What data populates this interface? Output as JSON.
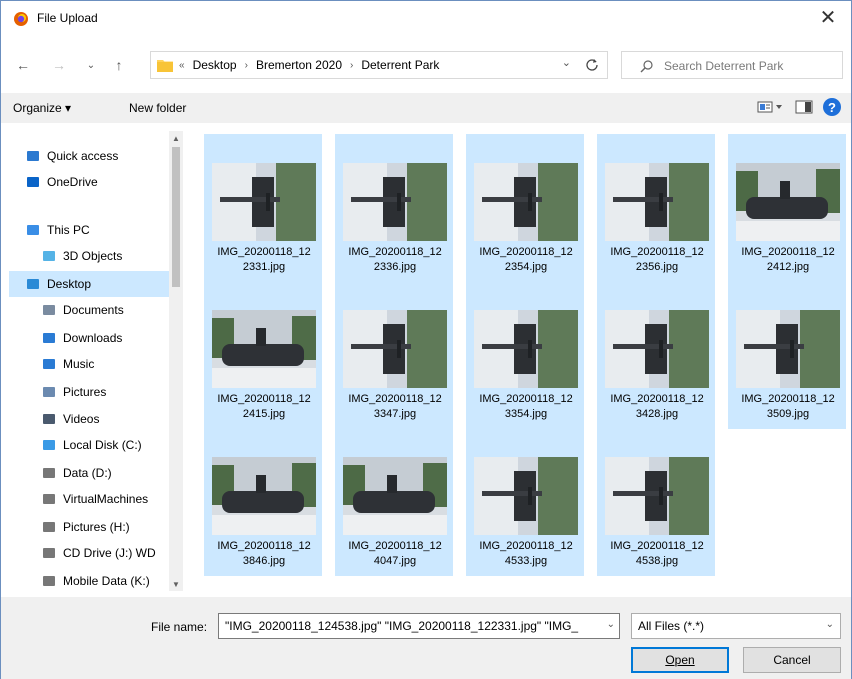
{
  "window": {
    "title": "File Upload",
    "close_glyph": "✕"
  },
  "nav": {
    "back_glyph": "←",
    "forward_glyph": "→",
    "recent_glyph": "⌄",
    "up_glyph": "↑",
    "prefix_glyph": "«",
    "breadcrumbs": [
      "Desktop",
      "Bremerton 2020",
      "Deterrent Park"
    ],
    "separator": "›",
    "search_placeholder": "Search Deterrent Park"
  },
  "commands": {
    "organize": "Organize ▾",
    "new_folder": "New folder",
    "help": "?"
  },
  "sidebar": {
    "items": [
      {
        "label": "Quick access",
        "icon": "star-icon",
        "color": "#2b79d0"
      },
      {
        "label": "OneDrive",
        "icon": "cloud-icon",
        "color": "#0a64c8"
      },
      {
        "label": "This PC",
        "icon": "computer-icon",
        "color": "#3a8ee6"
      },
      {
        "label": "3D Objects",
        "icon": "cube-icon",
        "color": "#55b3e6"
      },
      {
        "label": "Desktop",
        "icon": "desktop-icon",
        "color": "#2a8ad6",
        "selected": true
      },
      {
        "label": "Documents",
        "icon": "document-icon",
        "color": "#7a8ba0"
      },
      {
        "label": "Downloads",
        "icon": "download-icon",
        "color": "#2a7bd4"
      },
      {
        "label": "Music",
        "icon": "music-icon",
        "color": "#2a7bd4"
      },
      {
        "label": "Pictures",
        "icon": "pictures-icon",
        "color": "#6b8ab0"
      },
      {
        "label": "Videos",
        "icon": "videos-icon",
        "color": "#4a5a6e"
      },
      {
        "label": "Local Disk (C:)",
        "icon": "disk-icon",
        "color": "#3a9ae6"
      },
      {
        "label": "Data (D:)",
        "icon": "drive-icon",
        "color": "#777777"
      },
      {
        "label": "VirtualMachines",
        "icon": "drive-icon",
        "color": "#777777"
      },
      {
        "label": "Pictures (H:)",
        "icon": "drive-icon",
        "color": "#777777"
      },
      {
        "label": "CD Drive (J:) WD",
        "icon": "cd-icon",
        "color": "#777777"
      },
      {
        "label": "Mobile Data (K:)",
        "icon": "drive-icon",
        "color": "#777777"
      }
    ]
  },
  "files": [
    {
      "name": "IMG_20200118_122331.jpg",
      "line1": "IMG_20200118_12",
      "line2": "2331.jpg",
      "rotated": true
    },
    {
      "name": "IMG_20200118_122336.jpg",
      "line1": "IMG_20200118_12",
      "line2": "2336.jpg",
      "rotated": true
    },
    {
      "name": "IMG_20200118_122354.jpg",
      "line1": "IMG_20200118_12",
      "line2": "2354.jpg",
      "rotated": true
    },
    {
      "name": "IMG_20200118_122356.jpg",
      "line1": "IMG_20200118_12",
      "line2": "2356.jpg",
      "rotated": true
    },
    {
      "name": "IMG_20200118_122412.jpg",
      "line1": "IMG_20200118_12",
      "line2": "2412.jpg",
      "rotated": false
    },
    {
      "name": "IMG_20200118_122415.jpg",
      "line1": "IMG_20200118_12",
      "line2": "2415.jpg",
      "rotated": false
    },
    {
      "name": "IMG_20200118_123347.jpg",
      "line1": "IMG_20200118_12",
      "line2": "3347.jpg",
      "rotated": true
    },
    {
      "name": "IMG_20200118_123354.jpg",
      "line1": "IMG_20200118_12",
      "line2": "3354.jpg",
      "rotated": true
    },
    {
      "name": "IMG_20200118_123428.jpg",
      "line1": "IMG_20200118_12",
      "line2": "3428.jpg",
      "rotated": true
    },
    {
      "name": "IMG_20200118_123509.jpg",
      "line1": "IMG_20200118_12",
      "line2": "3509.jpg",
      "rotated": true
    },
    {
      "name": "IMG_20200118_123846.jpg",
      "line1": "IMG_20200118_12",
      "line2": "3846.jpg",
      "rotated": false
    },
    {
      "name": "IMG_20200118_124047.jpg",
      "line1": "IMG_20200118_12",
      "line2": "4047.jpg",
      "rotated": false
    },
    {
      "name": "IMG_20200118_124533.jpg",
      "line1": "IMG_20200118_12",
      "line2": "4533.jpg",
      "rotated": true
    },
    {
      "name": "IMG_20200118_124538.jpg",
      "line1": "IMG_20200118_12",
      "line2": "4538.jpg",
      "rotated": true
    }
  ],
  "footer": {
    "filename_label": "File name:",
    "filename_value": "\"IMG_20200118_124538.jpg\" \"IMG_20200118_122331.jpg\" \"IMG_",
    "filetype_value": "All Files (*.*)",
    "open_label": "Open",
    "cancel_label": "Cancel"
  },
  "colors": {
    "selection": "#cce8ff",
    "accent": "#0078d7"
  }
}
